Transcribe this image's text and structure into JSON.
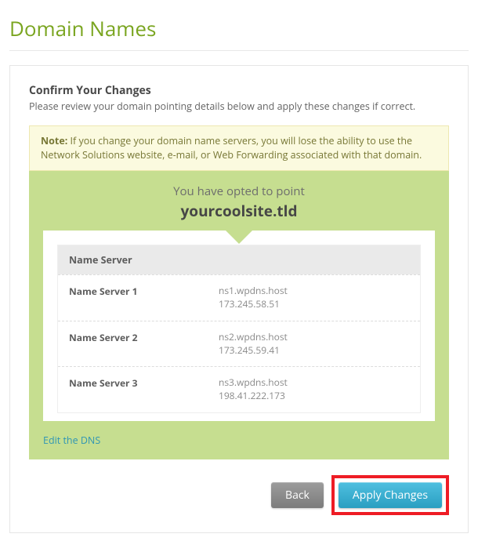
{
  "page": {
    "title": "Domain Names"
  },
  "confirm": {
    "heading": "Confirm Your Changes",
    "sub": "Please review your domain pointing details below and apply these changes if correct."
  },
  "note": {
    "label": "Note:",
    "text": " If you change your domain name servers, you will lose the ability to use the Network Solutions website, e-mail, or Web Forwarding associated with that domain."
  },
  "point": {
    "opted": "You have opted to point",
    "domain": "yourcoolsite.tld"
  },
  "ns": {
    "header": "Name Server",
    "rows": [
      {
        "label": "Name Server 1",
        "host": "ns1.wpdns.host",
        "ip": "173.245.58.51"
      },
      {
        "label": "Name Server 2",
        "host": "ns2.wpdns.host",
        "ip": "173.245.59.41"
      },
      {
        "label": "Name Server 3",
        "host": "ns3.wpdns.host",
        "ip": "198.41.222.173"
      }
    ]
  },
  "links": {
    "edit_dns": "Edit the DNS"
  },
  "buttons": {
    "back": "Back",
    "apply": "Apply Changes"
  }
}
